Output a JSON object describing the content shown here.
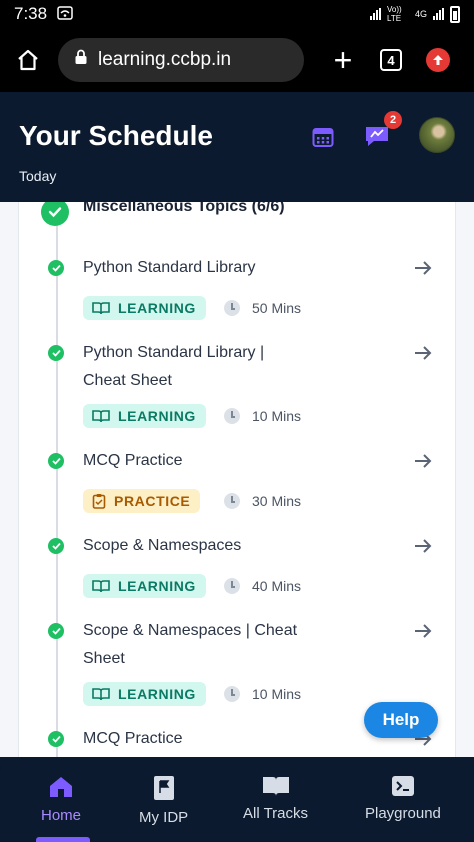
{
  "status_bar": {
    "time": "7:38",
    "carrier": "Vo)) LTE",
    "network": "4G"
  },
  "browser": {
    "url": "learning.ccbp.in",
    "tab_count": "4"
  },
  "header": {
    "title": "Your Schedule",
    "subtitle": "Today",
    "notification_count": "2"
  },
  "topic": {
    "title": "Miscellaneous Topics (6/6)"
  },
  "items": [
    {
      "title": "Python Standard Library",
      "tag": "LEARNING",
      "duration": "50 Mins"
    },
    {
      "title": "Python Standard Library | Cheat Sheet",
      "tag": "LEARNING",
      "duration": "10 Mins"
    },
    {
      "title": "MCQ Practice",
      "tag": "PRACTICE",
      "duration": "30 Mins"
    },
    {
      "title": "Scope & Namespaces",
      "tag": "LEARNING",
      "duration": "40 Mins"
    },
    {
      "title": "Scope & Namespaces | Cheat Sheet",
      "tag": "LEARNING",
      "duration": "10 Mins"
    },
    {
      "title": "MCQ Practice"
    }
  ],
  "help_label": "Help",
  "nav": [
    {
      "label": "Home"
    },
    {
      "label": "My IDP"
    },
    {
      "label": "All Tracks"
    },
    {
      "label": "Playground"
    }
  ],
  "colors": {
    "header_bg": "#0b1a2e",
    "accent": "#7c5cff",
    "success": "#1fbf63",
    "learning_bg": "#d2f7ef",
    "learning_text": "#0b7a64",
    "practice_bg": "#fdf0c7",
    "practice_text": "#a75a00",
    "help": "#1b86e3"
  }
}
